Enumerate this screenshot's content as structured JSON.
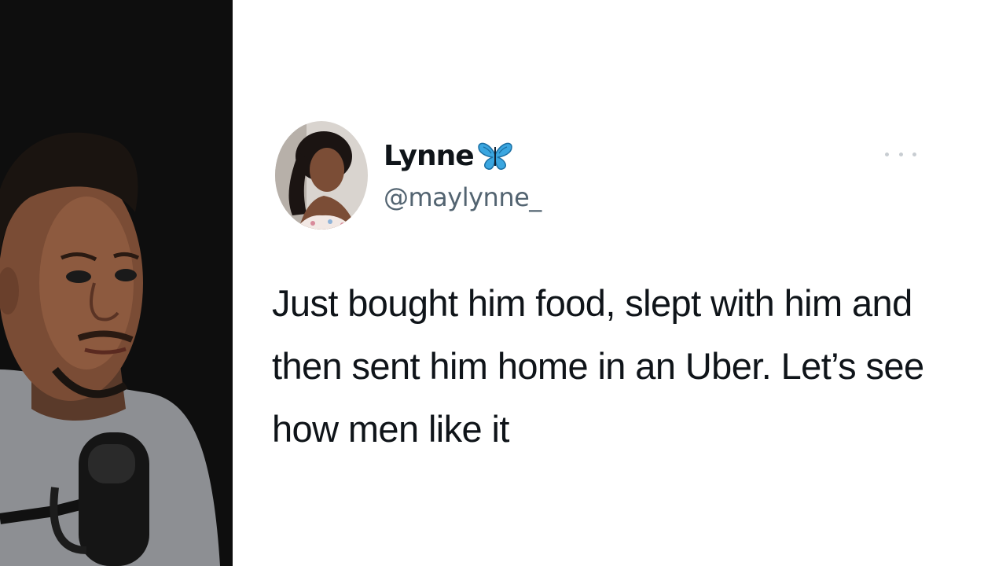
{
  "tweet": {
    "display_name": "Lynne",
    "handle": "@maylynne_",
    "text": "Just bought him food, slept with him and\nthen sent him home in an Uber. Let’s see\nhow men like it",
    "verified_icon": "butterfly-icon",
    "more_icon": "more-icon"
  },
  "colors": {
    "webcam_background": "#0e0e0e",
    "tweet_background": "#ffffff",
    "name_color": "#0f1419",
    "handle_color": "#536471",
    "butterfly_color": "#3aa6e0"
  }
}
